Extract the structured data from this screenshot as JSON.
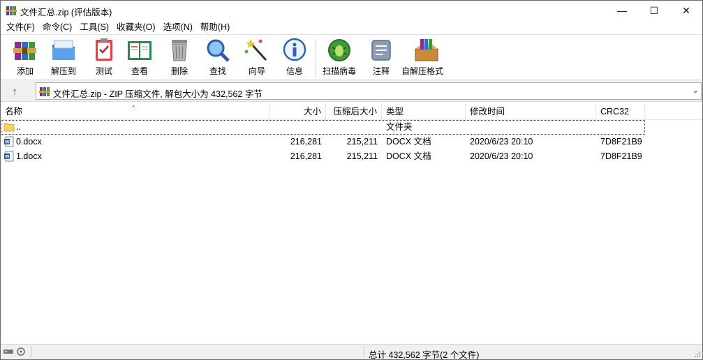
{
  "window": {
    "title": "文件汇总.zip (评估版本)",
    "controls": {
      "minimize": "—",
      "maximize": "☐",
      "close": "✕"
    }
  },
  "menu": [
    "文件(F)",
    "命令(C)",
    "工具(S)",
    "收藏夹(O)",
    "选项(N)",
    "帮助(H)"
  ],
  "toolbar": [
    {
      "label": "添加",
      "icon": "add-archive-icon"
    },
    {
      "label": "解压到",
      "icon": "extract-to-icon"
    },
    {
      "label": "测试",
      "icon": "test-icon"
    },
    {
      "label": "查看",
      "icon": "view-book-icon"
    },
    {
      "label": "删除",
      "icon": "trash-icon"
    },
    {
      "label": "查找",
      "icon": "magnifier-icon"
    },
    {
      "label": "向导",
      "icon": "wizard-wand-icon"
    },
    {
      "label": "信息",
      "icon": "info-icon"
    },
    {
      "label": "扫描病毒",
      "icon": "virus-scan-icon"
    },
    {
      "label": "注释",
      "icon": "comment-icon"
    },
    {
      "label": "自解压格式",
      "icon": "sfx-box-icon"
    }
  ],
  "address": {
    "up": "↑",
    "text": "文件汇总.zip - ZIP 压缩文件, 解包大小为 432,562 字节",
    "dropdown": "⌄"
  },
  "columns": {
    "name": "名称",
    "size": "大小",
    "packed": "压缩后大小",
    "type": "类型",
    "modified": "修改时间",
    "crc": "CRC32",
    "sort_arrow": "^"
  },
  "rows": [
    {
      "name": "..",
      "size": "",
      "packed": "",
      "type": "文件夹",
      "modified": "",
      "crc": "",
      "icon": "folder-icon"
    },
    {
      "name": "0.docx",
      "size": "216,281",
      "packed": "215,211",
      "type": "DOCX 文档",
      "modified": "2020/6/23 20:10",
      "crc": "7D8F21B9",
      "icon": "word-doc-icon"
    },
    {
      "name": "1.docx",
      "size": "216,281",
      "packed": "215,211",
      "type": "DOCX 文档",
      "modified": "2020/6/23 20:10",
      "crc": "7D8F21B9",
      "icon": "word-doc-icon"
    }
  ],
  "status": {
    "summary": "总计 432,562 字节(2 个文件)"
  }
}
